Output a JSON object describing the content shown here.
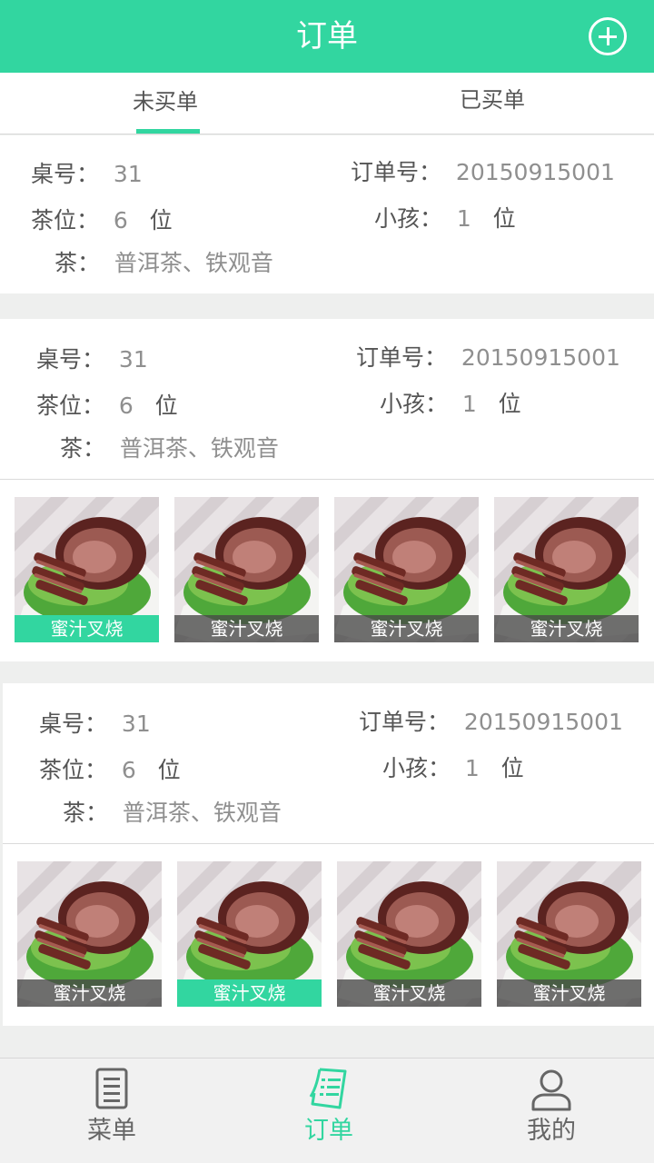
{
  "header": {
    "title": "订单"
  },
  "tabs": {
    "unpaid": "未买单",
    "paid": "已买单"
  },
  "labels": {
    "table": "桌号：",
    "order": "订单号：",
    "tea_seats": "茶位：",
    "children": "小孩：",
    "tea": "茶：",
    "unit": "位"
  },
  "orders": [
    {
      "table": "31",
      "order_no": "20150915001",
      "tea_seats": "6",
      "children": "1",
      "tea": "普洱茶、铁观音",
      "dishes": []
    },
    {
      "table": "31",
      "order_no": "20150915001",
      "tea_seats": "6",
      "children": "1",
      "tea": "普洱茶、铁观音",
      "dishes": [
        {
          "name": "蜜汁叉烧",
          "selected": true
        },
        {
          "name": "蜜汁叉烧",
          "selected": false
        },
        {
          "name": "蜜汁叉烧",
          "selected": false
        },
        {
          "name": "蜜汁叉烧",
          "selected": false
        }
      ]
    },
    {
      "table": "31",
      "order_no": "20150915001",
      "tea_seats": "6",
      "children": "1",
      "tea": "普洱茶、铁观音",
      "dishes": [
        {
          "name": "蜜汁叉烧",
          "selected": false
        },
        {
          "name": "蜜汁叉烧",
          "selected": true
        },
        {
          "name": "蜜汁叉烧",
          "selected": false
        },
        {
          "name": "蜜汁叉烧",
          "selected": false
        }
      ]
    }
  ],
  "tabbar": {
    "items": [
      {
        "label": "菜单",
        "icon": "menu-list-icon"
      },
      {
        "label": "订单",
        "icon": "order-receipt-icon"
      },
      {
        "label": "我的",
        "icon": "user-profile-icon"
      }
    ]
  },
  "colors": {
    "accent": "#32d6a0",
    "label_bg": "#484848"
  }
}
